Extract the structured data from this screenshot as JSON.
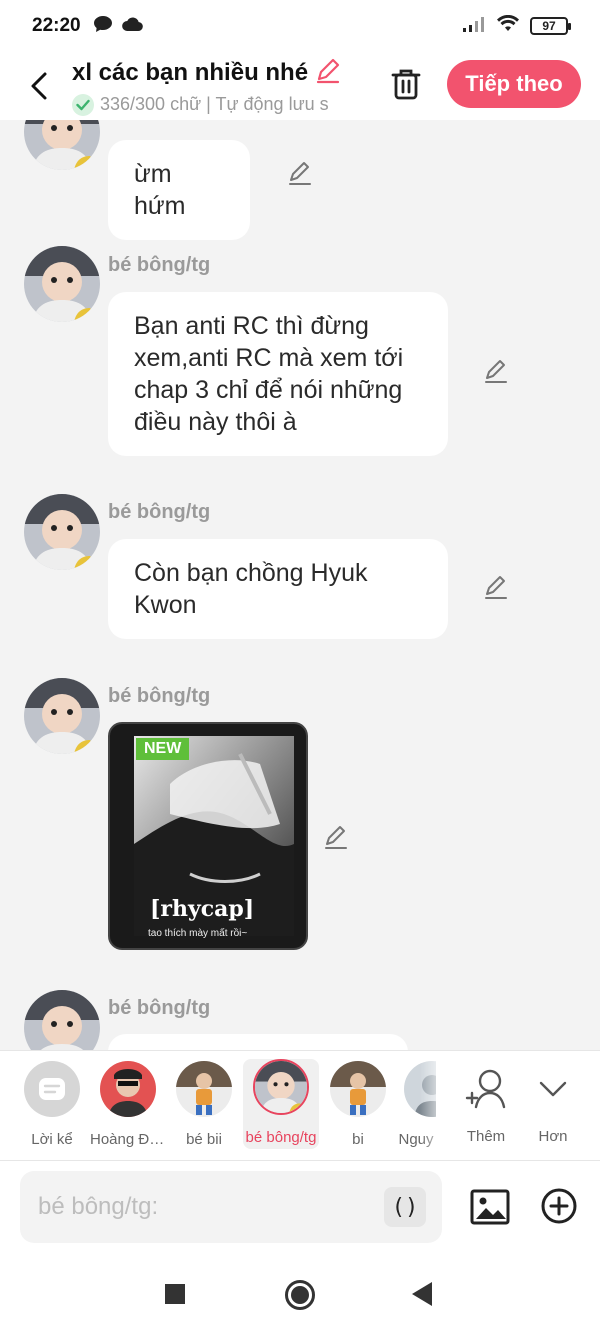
{
  "status": {
    "time": "22:20",
    "battery": "97"
  },
  "header": {
    "title": "xl các bạn nhiều nhé",
    "subtitle": "336/300 chữ | Tự động lưu s",
    "next_label": "Tiếp theo"
  },
  "messages": [
    {
      "sender": "",
      "text": "ừm hứm"
    },
    {
      "sender": "bé bông/tg",
      "text": "Bạn anti RC thì đừng xem,anti RC mà xem tới chap 3 chỉ để nói những điều này thôi à"
    },
    {
      "sender": "bé bông/tg",
      "text": "Còn bạn chồng Hyuk Kwon"
    },
    {
      "sender": "bé bông/tg",
      "image": {
        "badge": "NEW",
        "title": "[rhycap]",
        "caption": "tao thích mày mất rồi~"
      }
    },
    {
      "sender": "bé bông/tg",
      "text": ""
    }
  ],
  "characters": [
    {
      "label": "Lời kể"
    },
    {
      "label": "Hoàng Đứ..."
    },
    {
      "label": "bé bii"
    },
    {
      "label": "bé bông/tg",
      "selected": true
    },
    {
      "label": "bi"
    },
    {
      "label": "Nguy"
    }
  ],
  "actions": {
    "more_label": "Thêm",
    "less_label": "Hơn"
  },
  "input": {
    "placeholder": "bé bông/tg:",
    "paren": "()"
  },
  "colors": {
    "accent": "#f2536e",
    "selected": "#e8445e"
  }
}
